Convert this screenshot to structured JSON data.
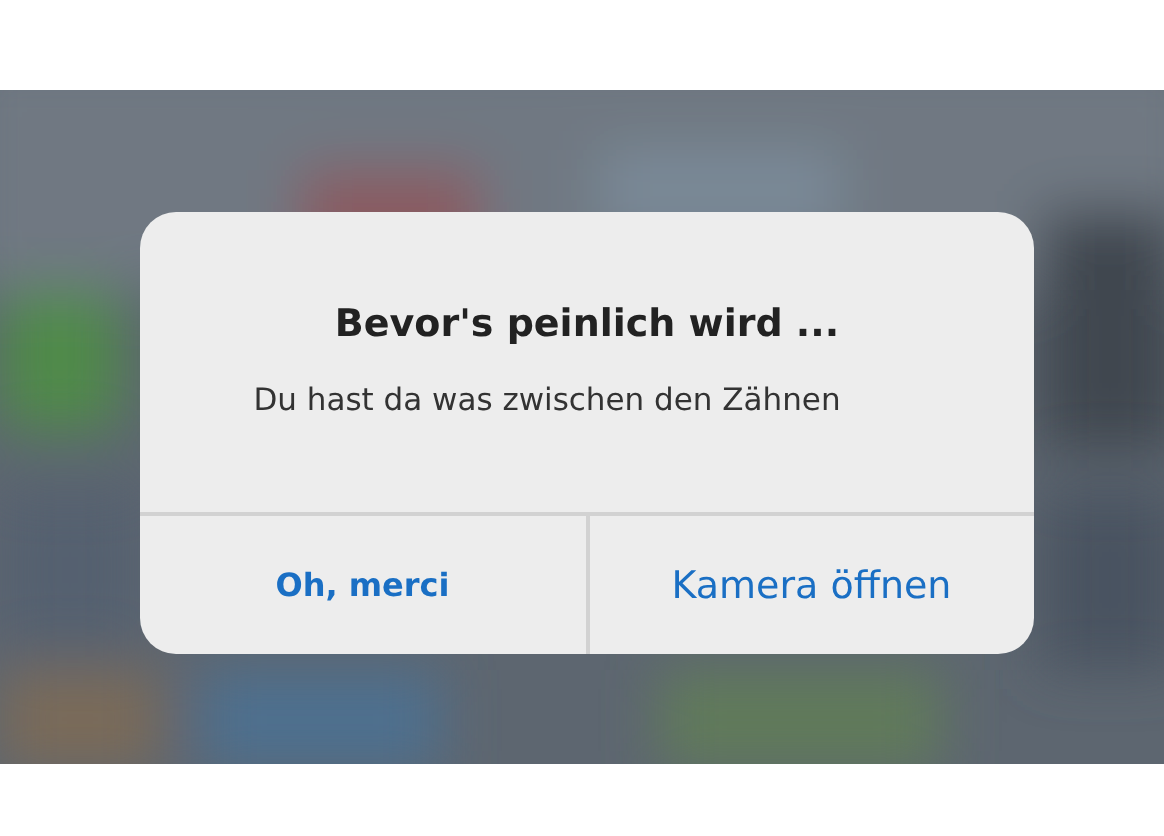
{
  "alert": {
    "title": "Bevor's peinlich wird ...",
    "message": "Du hast da was zwischen den Zähnen",
    "buttons": [
      {
        "label": "Oh, merci",
        "kind": "preferred"
      },
      {
        "label": "Kamera öffnen",
        "kind": "default"
      }
    ]
  }
}
